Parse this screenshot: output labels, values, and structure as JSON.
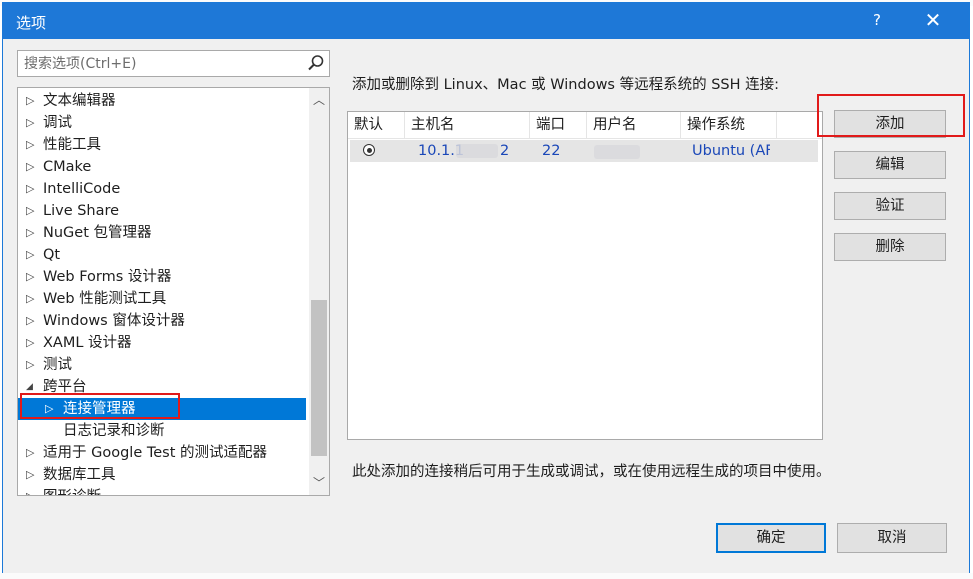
{
  "dialog": {
    "title": "选项",
    "help_glyph": "?",
    "close_glyph": "✕"
  },
  "search": {
    "placeholder": "搜索选项(Ctrl+E)"
  },
  "tree": {
    "items": [
      {
        "label": "文本编辑器",
        "arrow": "▷"
      },
      {
        "label": "调试",
        "arrow": "▷"
      },
      {
        "label": "性能工具",
        "arrow": "▷"
      },
      {
        "label": "CMake",
        "arrow": "▷"
      },
      {
        "label": "IntelliCode",
        "arrow": "▷"
      },
      {
        "label": "Live Share",
        "arrow": "▷"
      },
      {
        "label": "NuGet 包管理器",
        "arrow": "▷"
      },
      {
        "label": "Qt",
        "arrow": "▷"
      },
      {
        "label": "Web Forms 设计器",
        "arrow": "▷"
      },
      {
        "label": "Web 性能测试工具",
        "arrow": "▷"
      },
      {
        "label": "Windows 窗体设计器",
        "arrow": "▷"
      },
      {
        "label": "XAML 设计器",
        "arrow": "▷"
      },
      {
        "label": "测试",
        "arrow": "▷"
      },
      {
        "label": "跨平台",
        "arrow": "◢"
      },
      {
        "label": "连接管理器",
        "arrow": "▷"
      },
      {
        "label": "日志记录和诊断",
        "arrow": ""
      },
      {
        "label": "适用于 Google Test 的测试适配器",
        "arrow": "▷"
      },
      {
        "label": "数据库工具",
        "arrow": "▷"
      },
      {
        "label": "图形诊断",
        "arrow": "▷"
      }
    ],
    "scroll_up": "︿",
    "scroll_down": "﹀"
  },
  "panel": {
    "instruction": "添加或删除到 Linux、Mac 或 Windows 等远程系统的 SSH 连接:",
    "columns": [
      "默认",
      "主机名",
      "端口",
      "用户名",
      "操作系统"
    ],
    "rows": [
      {
        "host": "10.1.1",
        "host_tail": "2",
        "port": "22",
        "user": "",
        "os": "Ubuntu (AF"
      }
    ],
    "note": "此处添加的连接稍后可用于生成或调试，或在使用远程生成的项目中使用。"
  },
  "buttons": {
    "add": "添加",
    "edit": "编辑",
    "verify": "验证",
    "delete": "删除",
    "ok": "确定",
    "cancel": "取消"
  },
  "colors": {
    "titlebar": "#1e78d7",
    "selection": "#0078d7",
    "highlight_box": "#e11a1a"
  }
}
